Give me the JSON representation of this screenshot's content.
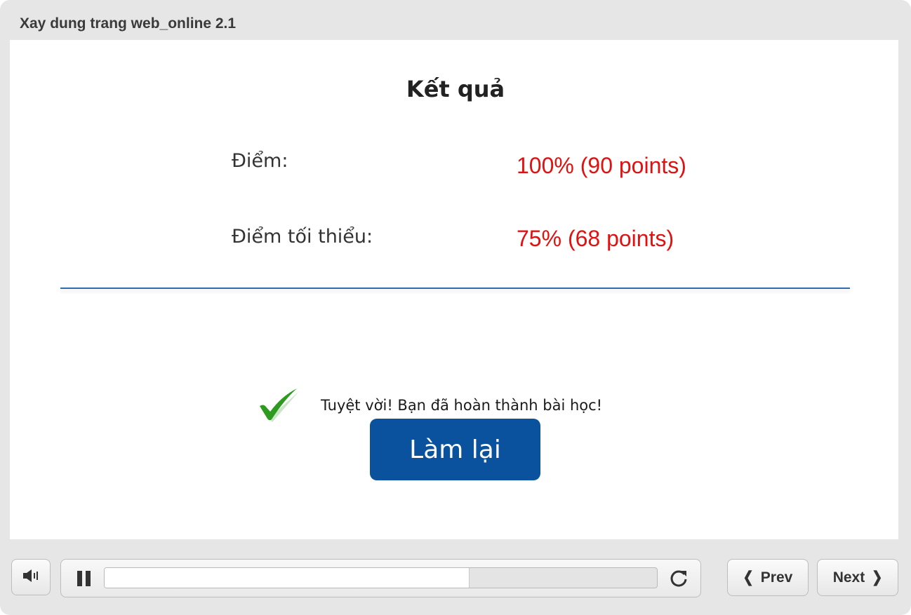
{
  "window": {
    "title": "Xay dung trang web_online 2.1"
  },
  "slide": {
    "heading": "Kết quả",
    "score": {
      "label": "Điểm:",
      "value": "100% (90 points)"
    },
    "passing": {
      "label": "Điểm tối thiểu:",
      "value": "75% (68 points)"
    },
    "feedback": "Tuyệt vời! Bạn đã hoàn thành bài học!",
    "retry_label": "Làm lại"
  },
  "controls": {
    "icons": {
      "volume": "volume-icon",
      "pause": "pause-icon",
      "replay": "replay-icon",
      "check": "check-icon"
    },
    "progress_fraction": 0.66,
    "prev_label": "Prev",
    "next_label": "Next"
  },
  "colors": {
    "value_red": "#e31010",
    "button_blue": "#0a519e",
    "divider_blue": "#2f6bb0",
    "check_green": "#2e9a1f"
  }
}
